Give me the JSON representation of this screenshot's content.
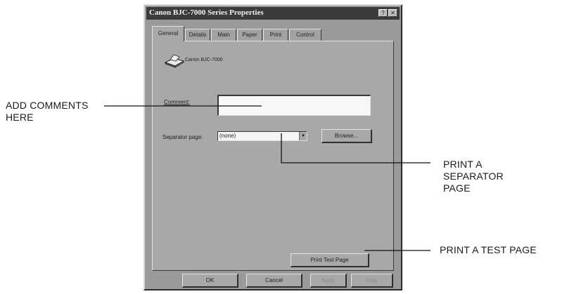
{
  "dialog": {
    "title": "Canon BJC-7000 Series Properties",
    "help_button": "?",
    "close_button": "✕",
    "tabs": [
      {
        "label": "General",
        "active": true
      },
      {
        "label": "Details",
        "active": false
      },
      {
        "label": "Main",
        "active": false
      },
      {
        "label": "Paper",
        "active": false
      },
      {
        "label": "Print",
        "active": false
      },
      {
        "label": "Control",
        "active": false
      }
    ],
    "printer_icon": "printer-icon",
    "printer_name": "Canon BJC-7000",
    "comment_label": "Comment:",
    "comment_value": "",
    "separator_label": "Separator page:",
    "separator_value": "(none)",
    "browse_button": "Browse...",
    "test_page_button": "Print Test Page",
    "buttons": {
      "ok": "OK",
      "cancel": "Cancel",
      "apply": "Apply",
      "help": "Help"
    }
  },
  "callouts": {
    "comments": [
      "ADD COMMENTS",
      "HERE"
    ],
    "separator": [
      "PRINT A",
      "SEPARATOR",
      "PAGE"
    ],
    "test_page": "PRINT A TEST PAGE"
  },
  "colors": {
    "window_face": "#a8a8a8",
    "title_bar": "#3b3b3b",
    "input_background": "#f7f7f7"
  }
}
